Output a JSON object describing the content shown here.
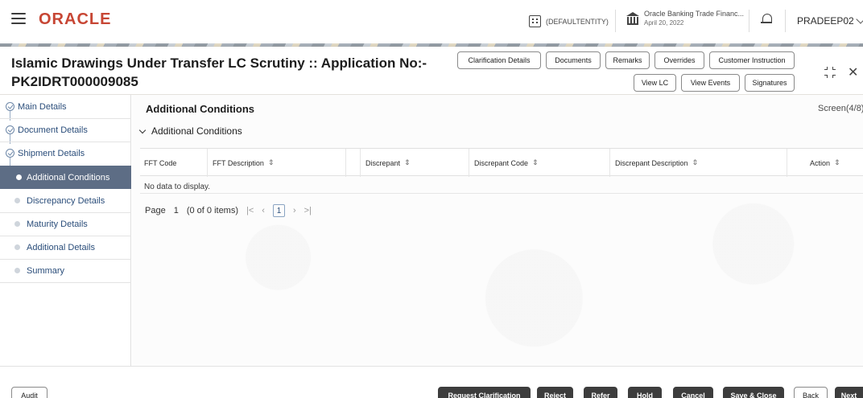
{
  "header": {
    "logo": "ORACLE",
    "entity": "(DEFAULTENTITY)",
    "bank_name": "Oracle Banking Trade Financ...",
    "bank_date": "April 20, 2022",
    "user": "PRADEEP02",
    "icons": [
      "hamburger-menu-icon",
      "building-icon",
      "bank-icon",
      "bell-icon",
      "chevron-down-icon"
    ]
  },
  "page": {
    "title": "Islamic Drawings Under Transfer LC Scrutiny :: Application No:- PK2IDRT000009085"
  },
  "toolbar": {
    "row1": [
      "Clarification Details",
      "Documents",
      "Remarks",
      "Overrides",
      "Customer Instruction"
    ],
    "row2": [
      "View LC",
      "View Events",
      "Signatures"
    ]
  },
  "sidebar": {
    "items": [
      {
        "label": "Main Details",
        "state": "done"
      },
      {
        "label": "Document Details",
        "state": "done"
      },
      {
        "label": "Shipment Details",
        "state": "done"
      },
      {
        "label": "Additional Conditions",
        "state": "active"
      },
      {
        "label": "Discrepancy Details",
        "state": "pending"
      },
      {
        "label": "Maturity Details",
        "state": "pending"
      },
      {
        "label": "Additional Details",
        "state": "pending"
      },
      {
        "label": "Summary",
        "state": "pending"
      }
    ]
  },
  "main": {
    "section_title": "Additional Conditions",
    "screen_indicator": "Screen(4/8)",
    "panel_title": "Additional Conditions",
    "table": {
      "columns": [
        "FFT Code",
        "FFT Description",
        "Discrepant",
        "Discrepant Code",
        "Discrepant Description",
        "Action"
      ],
      "empty_text": "No data to display."
    },
    "pager": {
      "page_label": "Page",
      "page_value": "1",
      "items_text": "(0 of 0 items)",
      "first": "|<",
      "prev": "‹",
      "current": "1",
      "next": "›",
      "last": ">|"
    }
  },
  "footer": {
    "audit": "Audit",
    "actions": [
      "Request Clarification",
      "Reject",
      "Refer",
      "Hold",
      "Cancel",
      "Save & Close"
    ],
    "back": "Back",
    "next": "Next"
  },
  "colors": {
    "brand": "#c74634",
    "active_nav": "#5d6d85",
    "nav_text": "#2a4d7a",
    "dark_button": "#3d3d3d"
  }
}
